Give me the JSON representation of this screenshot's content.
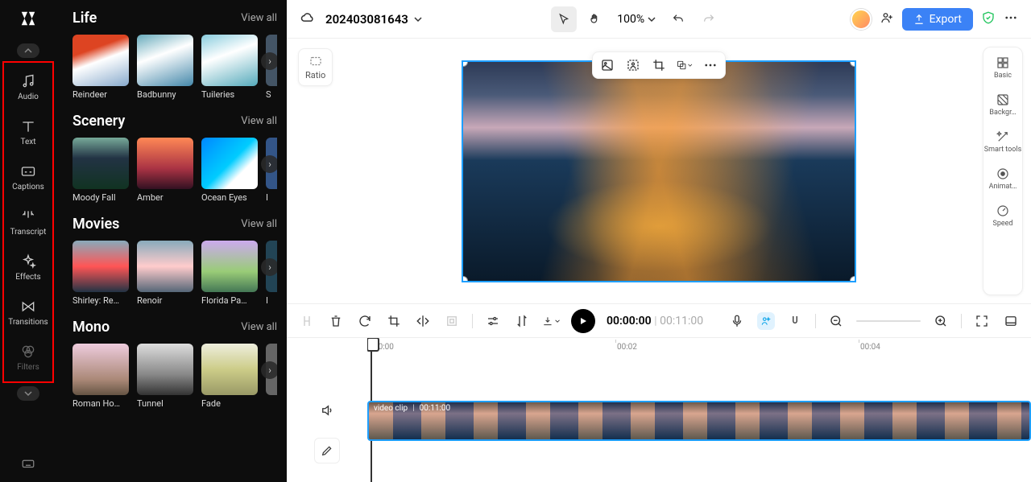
{
  "app": {
    "logo_text": "✕"
  },
  "nav": {
    "items": [
      {
        "label": "Audio"
      },
      {
        "label": "Text"
      },
      {
        "label": "Captions"
      },
      {
        "label": "Transcript"
      },
      {
        "label": "Effects"
      },
      {
        "label": "Transitions"
      },
      {
        "label": "Filters"
      }
    ]
  },
  "assets": {
    "view_all": "View all",
    "sections": [
      {
        "title": "Life",
        "items": [
          {
            "label": "Reindeer"
          },
          {
            "label": "Badbunny"
          },
          {
            "label": "Tuileries"
          },
          {
            "label": "S"
          }
        ]
      },
      {
        "title": "Scenery",
        "items": [
          {
            "label": "Moody Fall"
          },
          {
            "label": "Amber"
          },
          {
            "label": "Ocean Eyes"
          },
          {
            "label": "I"
          }
        ]
      },
      {
        "title": "Movies",
        "items": [
          {
            "label": "Shirley: Re…"
          },
          {
            "label": "Renoir"
          },
          {
            "label": "Florida Pa…"
          },
          {
            "label": "I"
          }
        ]
      },
      {
        "title": "Mono",
        "items": [
          {
            "label": "Roman Ho…"
          },
          {
            "label": "Tunnel"
          },
          {
            "label": "Fade"
          },
          {
            "label": ""
          }
        ]
      }
    ]
  },
  "top": {
    "project_name": "202403081643",
    "zoom": "100%",
    "export": "Export"
  },
  "ratio": {
    "label": "Ratio"
  },
  "right_panel": {
    "items": [
      {
        "label": "Basic"
      },
      {
        "label": "Backgr…"
      },
      {
        "label": "Smart tools"
      },
      {
        "label": "Animat…"
      },
      {
        "label": "Speed"
      }
    ]
  },
  "timeline": {
    "current": "00:00:00",
    "total": "00:11:00",
    "ticks": [
      "00:00",
      "00:02",
      "00:04"
    ],
    "clip_name": "video clip",
    "clip_duration": "00:11:00"
  },
  "colors": {
    "accent": "#1e9fff",
    "export": "#3b82f6"
  },
  "thumb_gradients": {
    "reindeer": "linear-gradient(160deg,#d42 30%,#fff 50%,#8ac 100%)",
    "badbunny": "linear-gradient(160deg,#6ab 0%,#fff 40%,#48a 100%)",
    "tuileries": "linear-gradient(160deg,#8cd 0%,#fff 40%,#5ab 100%)",
    "moodyfall": "linear-gradient(to bottom,#7a9 0%,#234 40%,#132 100%)",
    "amber": "linear-gradient(to bottom,#f85 0%,#a34 60%,#312 100%)",
    "oceaneyes": "linear-gradient(135deg,#08f 0%,#0cf 50%,#fff 70%)",
    "shirley": "linear-gradient(to bottom,#8ab 0%,#f55 50%,#234 100%)",
    "renoir": "linear-gradient(to bottom,#8ab 0%,#fcc 50%,#567 100%)",
    "florida": "linear-gradient(to bottom,#cae 0%,#9c7 60%,#475 100%)",
    "roman": "linear-gradient(to bottom,#ecd 0%,#a87 70%,#654 100%)",
    "tunnel": "linear-gradient(to bottom,#ddd 0%,#888 60%,#333 100%)",
    "fade": "linear-gradient(to bottom,#eed 0%,#cc8 50%,#996 100%)"
  }
}
